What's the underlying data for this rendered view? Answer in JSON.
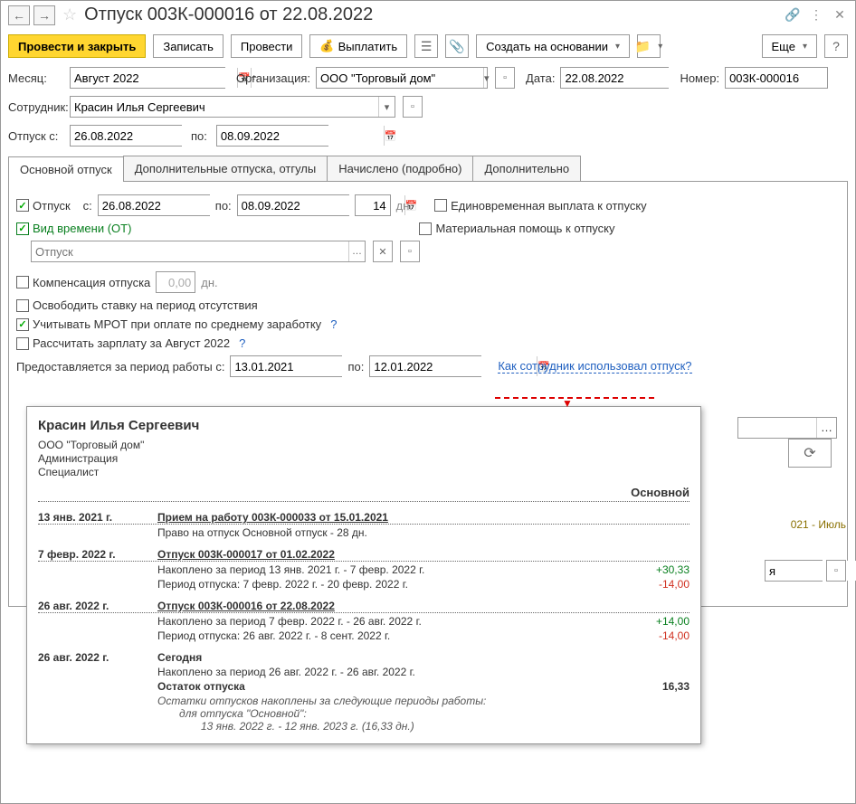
{
  "window": {
    "title": "Отпуск 003К-000016 от 22.08.2022"
  },
  "toolbar": {
    "post_close": "Провести и закрыть",
    "save": "Записать",
    "post": "Провести",
    "pay": "Выплатить",
    "create_based": "Создать на основании",
    "more": "Еще"
  },
  "form": {
    "month_lbl": "Месяц:",
    "month_val": "Август 2022",
    "org_lbl": "Организация:",
    "org_val": "ООО \"Торговый дом\"",
    "date_lbl": "Дата:",
    "date_val": "22.08.2022",
    "number_lbl": "Номер:",
    "number_val": "003К-000016",
    "employee_lbl": "Сотрудник:",
    "employee_val": "Красин Илья Сергеевич",
    "vac_from_lbl": "Отпуск с:",
    "vac_from_val": "26.08.2022",
    "vac_to_lbl": "по:",
    "vac_to_val": "08.09.2022"
  },
  "tabs": {
    "main": "Основной отпуск",
    "addl": "Дополнительные отпуска, отгулы",
    "calc": "Начислено (подробно)",
    "extra": "Дополнительно"
  },
  "main_tab": {
    "vacation_lbl": "Отпуск",
    "from_lbl": "с:",
    "from_val": "26.08.2022",
    "to_lbl": "по:",
    "to_val": "08.09.2022",
    "days_val": "14",
    "days_unit": "дн.",
    "time_type_lbl": "Вид времени (ОТ)",
    "time_type_placeholder": "Отпуск",
    "lump_sum_lbl": "Единовременная выплата к отпуску",
    "mat_help_lbl": "Материальная помощь к отпуску",
    "compensation_lbl": "Компенсация отпуска",
    "compensation_val": "0,00",
    "compensation_unit": "дн.",
    "release_lbl": "Освободить ставку на период отсутствия",
    "mrot_lbl": "Учитывать МРОТ при оплате по среднему заработку",
    "calc_salary_lbl": "Рассчитать зарплату за Август 2022",
    "period_lbl": "Предоставляется за период работы с:",
    "period_from": "13.01.2021",
    "period_to_lbl": "по:",
    "period_to": "12.01.2022",
    "usage_link": "Как сотрудник использовал отпуск?"
  },
  "background": {
    "period_text": "021 - Июль",
    "ya_text": "я"
  },
  "popup": {
    "employee": "Красин Илья Сергеевич",
    "org": "ООО \"Торговый дом\"",
    "dept": "Администрация",
    "position": "Специалист",
    "col_main": "Основной",
    "events": [
      {
        "date": "13 янв. 2021 г.",
        "title": "Прием на работу 003К-000033 от 15.01.2021",
        "lines": [
          {
            "desc": "Право на отпуск Основной отпуск - 28 дн.",
            "val": ""
          }
        ]
      },
      {
        "date": "7 февр. 2022 г.",
        "title": "Отпуск 003К-000017 от 01.02.2022",
        "lines": [
          {
            "desc": "Накоплено за период 13 янв. 2021 г. - 7 февр. 2022 г.",
            "val": "+30,33",
            "cls": "pos"
          },
          {
            "desc": "Период отпуска: 7 февр. 2022 г. - 20 февр. 2022 г.",
            "val": "-14,00",
            "cls": "neg"
          }
        ]
      },
      {
        "date": "26 авг. 2022 г.",
        "title": "Отпуск 003К-000016 от 22.08.2022",
        "lines": [
          {
            "desc": "Накоплено за период 7 февр. 2022 г. - 26 авг. 2022 г.",
            "val": "+14,00",
            "cls": "pos"
          },
          {
            "desc": "Период отпуска: 26 авг. 2022 г. - 8 сент. 2022 г.",
            "val": "-14,00",
            "cls": "neg"
          }
        ]
      }
    ],
    "today_date": "26 авг. 2022 г.",
    "today_lbl": "Сегодня",
    "today_accum": "Накоплено за период 26 авг. 2022 г. - 26 авг. 2022 г.",
    "balance_lbl": "Остаток отпуска",
    "balance_val": "16,33",
    "footnote1": "Остатки отпусков накоплены за следующие периоды работы:",
    "footnote2": "для отпуска \"Основной\":",
    "footnote3": "13 янв. 2022 г. - 12 янв. 2023 г. (16,33 дн.)"
  }
}
